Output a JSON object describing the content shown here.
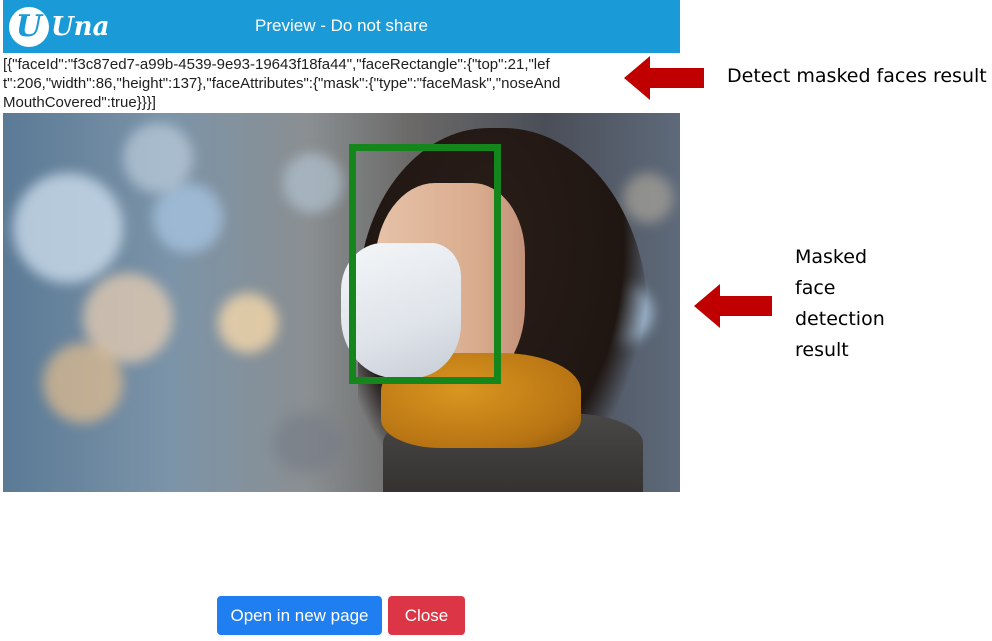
{
  "header": {
    "logo_letter": "U",
    "logo_word": "Una",
    "title": "Preview - Do not share",
    "color": "#1a9bd7"
  },
  "result": {
    "json_text": "[{\"faceId\":\"f3c87ed7-a99b-4539-9e93-19643f18fa44\",\"faceRectangle\":{\"top\":21,\"left\":206,\"width\":86,\"height\":137},\"faceAttributes\":{\"mask\":{\"type\":\"faceMask\",\"noseAndMouthCovered\":true}}}]"
  },
  "annotations": {
    "detect_result_label": "Detect masked faces result",
    "masked_face_label_lines": [
      "Masked",
      "face",
      "detection",
      "result"
    ],
    "arrow_color": "#c00000"
  },
  "image": {
    "box_color": "#15861b"
  },
  "buttons": {
    "open_label": "Open in new page",
    "close_label": "Close",
    "open_color": "#1f7ef0",
    "close_color": "#dc3545"
  }
}
